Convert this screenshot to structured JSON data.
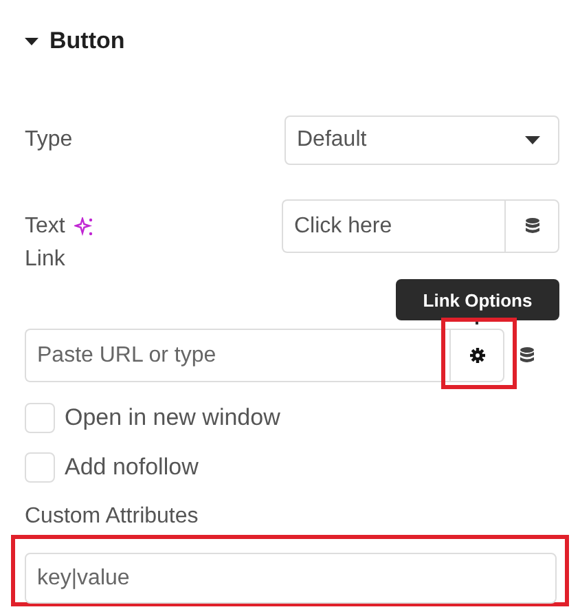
{
  "section": {
    "title": "Button",
    "expanded": true
  },
  "type_field": {
    "label": "Type",
    "value": "Default"
  },
  "text_field": {
    "label": "Text",
    "value": "Click here"
  },
  "link_field": {
    "label": "Link",
    "placeholder": "Paste URL or type",
    "tooltip": "Link Options",
    "options_highlighted": true
  },
  "checkboxes": [
    {
      "label": "Open in new window",
      "checked": false
    },
    {
      "label": "Add nofollow",
      "checked": false
    }
  ],
  "custom_attributes": {
    "label": "Custom Attributes",
    "placeholder": "key|value",
    "highlighted": true
  }
}
